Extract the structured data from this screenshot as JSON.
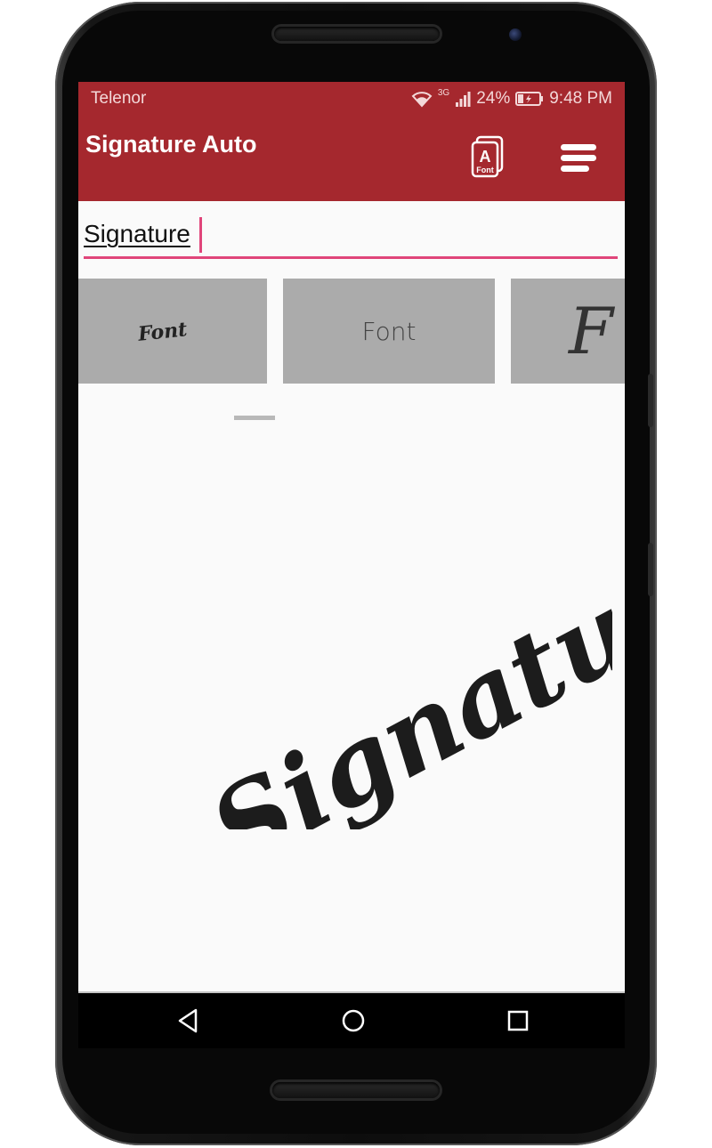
{
  "status_bar": {
    "carrier": "Telenor",
    "network_type": "3G",
    "battery": "24%",
    "time": "9:48 PM",
    "icons": [
      "wifi-icon",
      "signal-icon",
      "battery-icon"
    ]
  },
  "app_bar": {
    "title": "Signature Auto",
    "font_icon_label": "Font",
    "icons": [
      "font-icon",
      "menu-icon"
    ]
  },
  "input": {
    "value": "Signature"
  },
  "font_samples": [
    {
      "label": "Font"
    },
    {
      "label": "Font"
    },
    {
      "label": "F"
    }
  ],
  "preview": {
    "signature_text": "Signature"
  },
  "nav_bar": {
    "icons": [
      "back-icon",
      "home-icon",
      "recents-icon"
    ]
  },
  "colors": {
    "primary": "#a5282e",
    "accent": "#e0457a",
    "tile": "#ababab",
    "background": "#fafafa"
  }
}
